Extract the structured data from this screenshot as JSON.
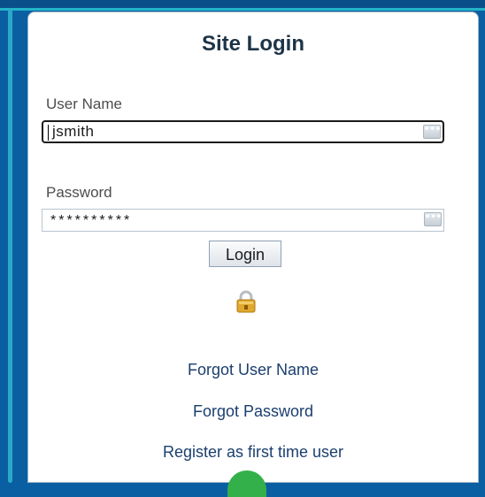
{
  "form": {
    "title": "Site Login",
    "username_label": "User Name",
    "username_value": "jsmith",
    "password_label": "Password",
    "password_value": "**********",
    "login_label": "Login",
    "lock_icon": "lock-icon",
    "ellipsis_icon": "ellipsis-icon"
  },
  "links": {
    "forgot_username": "Forgot User Name",
    "forgot_password": "Forgot Password",
    "register": "Register as first time user"
  },
  "colors": {
    "background": "#0a5fa3",
    "accent": "#2aa9c6",
    "link": "#1b3f6e",
    "lock": "#e0a82e"
  }
}
